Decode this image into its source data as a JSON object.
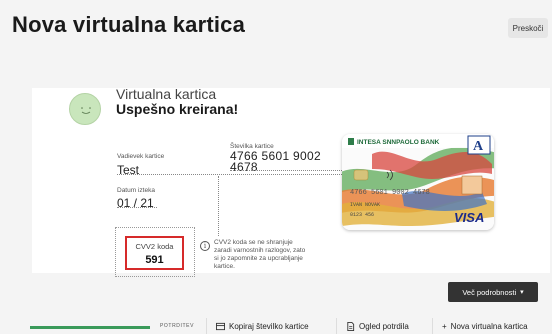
{
  "header": {
    "title": "Nova virtualna kartica",
    "skip_label": "Preskoči"
  },
  "confirmation": {
    "title": "Virtualna kartica",
    "status": "Uspešno kreirana!"
  },
  "card_details": {
    "owner_label": "Vadievek kartice",
    "owner_value": "Test",
    "number_label": "Številka kartice",
    "number_line1": "4766 5601 9002",
    "number_line2": "4678",
    "expiry_label": "Datum izteka",
    "expiry_value": "01 / 21"
  },
  "cvv": {
    "label": "CVV2 koda",
    "value": "591",
    "note": "CVV2 koda se ne shranjuje zaradi varnostnih razlogov, zato si jo zapomnite za upcrabljanje kartice."
  },
  "card_image": {
    "bank_name": "INTESA SANPAOLO BANK",
    "brand": "VISA",
    "number_hint": "4766 5601 9002 4678",
    "name_hint": "IVAN NOVAK",
    "bottom_text": "0123 456"
  },
  "more_button": {
    "label": "Več podrobnosti"
  },
  "footer": {
    "progress": 1.0,
    "step_label": "POTRDITEV",
    "copy_label": "Kopiraj številko kartice",
    "receipt_label": "Ogled potrdila",
    "new_card_label": "Nova virtualna kartica"
  },
  "colors": {
    "accent_green": "#3a9a5a",
    "cvv_red": "#d62a2a",
    "dark_button": "#333333"
  }
}
